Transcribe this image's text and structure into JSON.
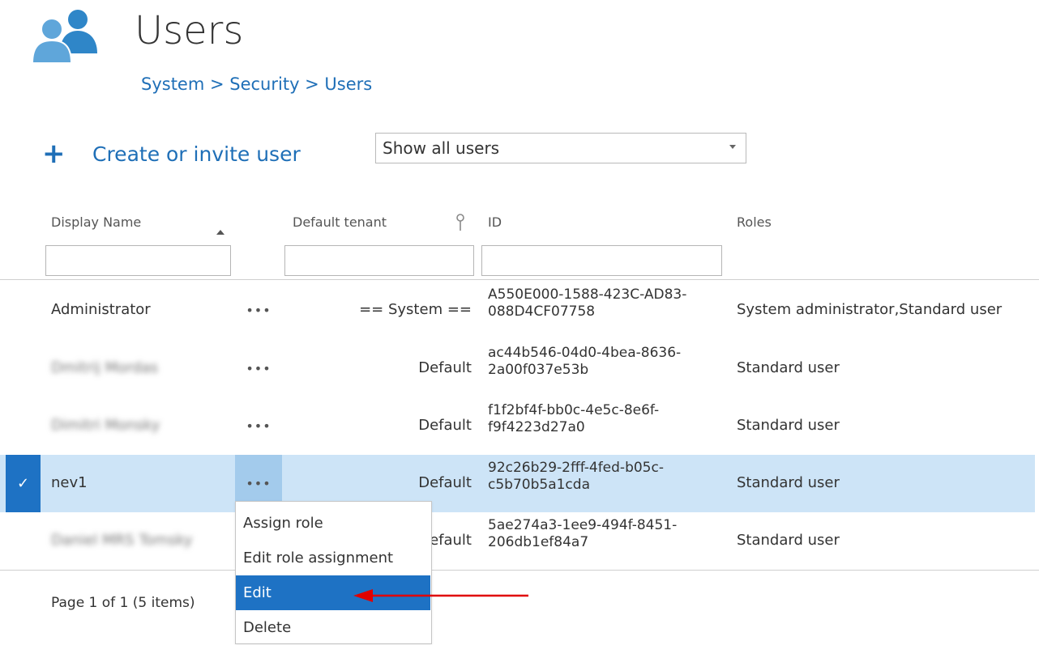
{
  "header": {
    "title": "Users",
    "breadcrumb": "System > Security > Users"
  },
  "toolbar": {
    "create_label": "Create or invite user",
    "filter_value": "Show all users"
  },
  "columns": {
    "display_name": "Display Name",
    "default_tenant": "Default tenant",
    "id": "ID",
    "roles": "Roles"
  },
  "rows": [
    {
      "name": "Administrator",
      "tenant": "== System ==",
      "id_line1": "A550E000-1588-423C-AD83-",
      "id_line2": "088D4CF07758",
      "roles": "System administrator,Standard user"
    },
    {
      "name": "Dmitrij Mordas",
      "tenant": "Default",
      "id_line1": "ac44b546-04d0-4bea-8636-",
      "id_line2": "2a00f037e53b",
      "roles": "Standard user"
    },
    {
      "name": "Dimitri Monsky",
      "tenant": "Default",
      "id_line1": "f1f2bf4f-bb0c-4e5c-8e6f-",
      "id_line2": "f9f4223d27a0",
      "roles": "Standard user"
    },
    {
      "name": "nev1",
      "tenant": "Default",
      "id_line1": "92c26b29-2fff-4fed-b05c-",
      "id_line2": "c5b70b5a1cda",
      "roles": "Standard user"
    },
    {
      "name": "Daniel MRS Tomsky",
      "tenant": "Default",
      "id_line1": "5ae274a3-1ee9-494f-8451-",
      "id_line2": "206db1ef84a7",
      "roles": "Standard user"
    }
  ],
  "row_more_icon": "•••",
  "selected_check_icon": "✓",
  "pager": "Page 1 of 1 (5 items)",
  "context_menu": {
    "items": [
      "Assign role",
      "Edit role assignment",
      "Edit",
      "Delete"
    ],
    "highlighted": "Edit"
  },
  "icons": {
    "header": "users-group-icon",
    "create": "plus-icon",
    "sort": "sort-ascending-icon",
    "pin": "pin-icon"
  },
  "colors": {
    "accent": "#1f6fb7",
    "selected_row": "#cde4f7",
    "selected_check": "#1e72c4",
    "arrow": "#e00000"
  }
}
